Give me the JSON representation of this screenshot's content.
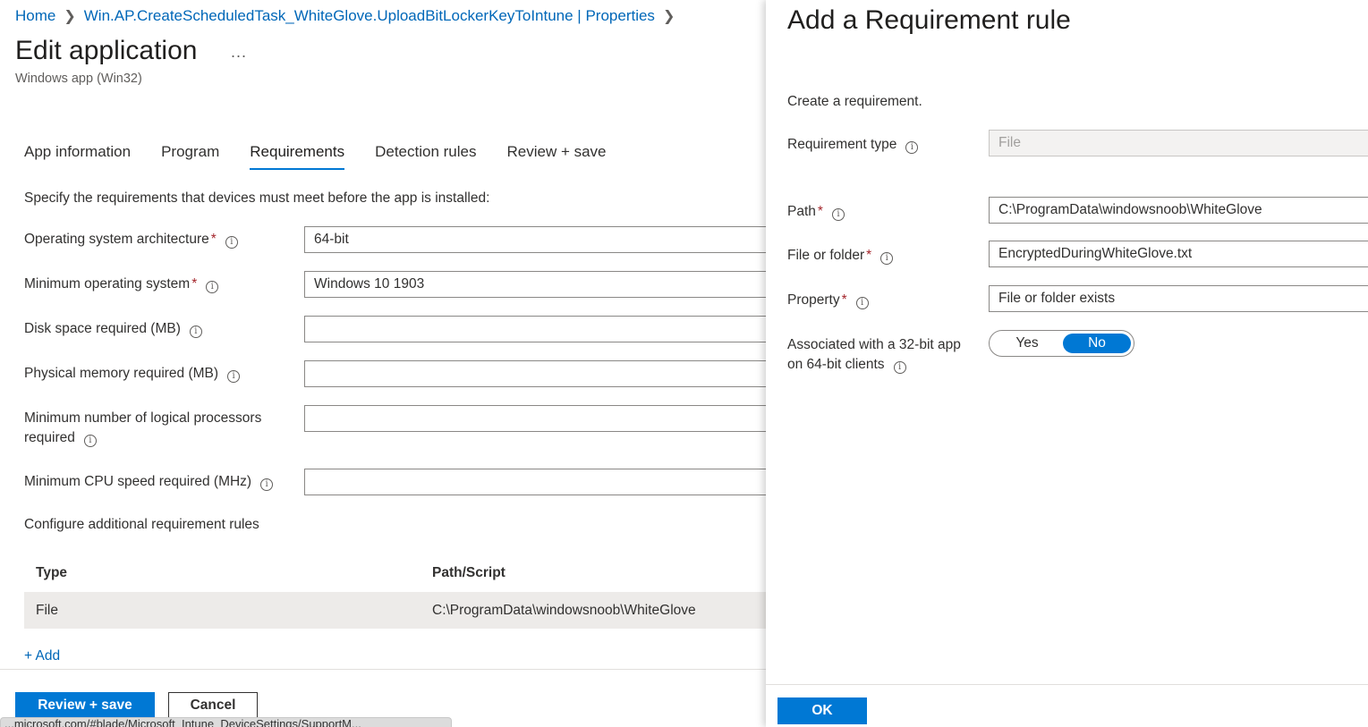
{
  "breadcrumb": {
    "home": "Home",
    "current": "Win.AP.CreateScheduledTask_WhiteGlove.UploadBitLockerKeyToIntune | Properties"
  },
  "header": {
    "title": "Edit application",
    "more": "...",
    "subtitle": "Windows app (Win32)"
  },
  "tabs": [
    "App information",
    "Program",
    "Requirements",
    "Detection rules",
    "Review + save"
  ],
  "requirements": {
    "intro": "Specify the requirements that devices must meet before the app is installed:",
    "os_arch_label": "Operating system architecture",
    "os_arch_value": "64-bit",
    "min_os_label": "Minimum operating system",
    "min_os_value": "Windows 10 1903",
    "disk_label": "Disk space required (MB)",
    "disk_value": "",
    "memory_label": "Physical memory required (MB)",
    "memory_value": "",
    "processors_label_1": "Minimum number of logical processors",
    "processors_label_2": "required",
    "processors_value": "",
    "cpu_label": "Minimum CPU speed required (MHz)",
    "cpu_value": ""
  },
  "rules": {
    "title": "Configure additional requirement rules",
    "columns": [
      "Type",
      "Path/Script"
    ],
    "rows": [
      {
        "type": "File",
        "path": "C:\\ProgramData\\windowsnoob\\WhiteGlove"
      }
    ],
    "add": "+ Add"
  },
  "footer": {
    "review_save": "Review + save",
    "cancel": "Cancel",
    "status_url": "...microsoft.com/#blade/Microsoft_Intune_DeviceSettings/SupportM..."
  },
  "panel": {
    "title": "Add a Requirement rule",
    "description": "Create a requirement.",
    "req_type_label": "Requirement type",
    "req_type_value": "File",
    "path_label": "Path",
    "path_value": "C:\\ProgramData\\windowsnoob\\WhiteGlove",
    "file_label": "File or folder",
    "file_value": "EncryptedDuringWhiteGlove.txt",
    "property_label": "Property",
    "property_value": "File or folder exists",
    "assoc_label_1": "Associated with a 32-bit app",
    "assoc_label_2": "on 64-bit clients",
    "toggle_yes": "Yes",
    "toggle_no": "No",
    "toggle_selected": "No",
    "ok": "OK"
  },
  "colors": {
    "accent": "#0078d4",
    "link": "#0067b8",
    "required": "#a4262c"
  },
  "icons": [
    "chevron-right-icon",
    "more-icon",
    "info-icon"
  ]
}
